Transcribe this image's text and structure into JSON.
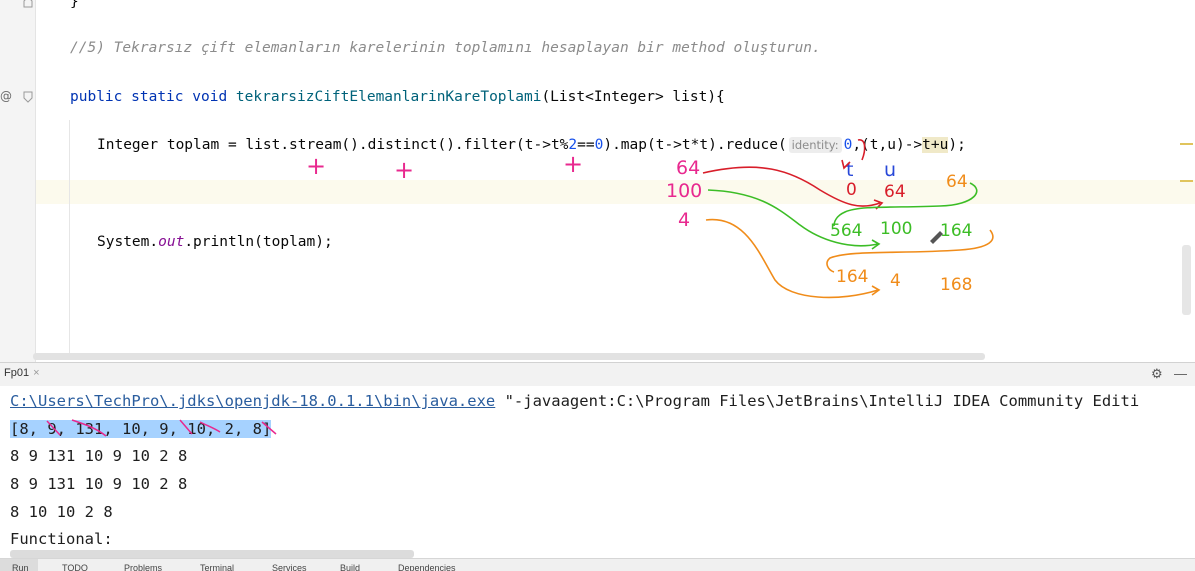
{
  "editor": {
    "closing_brace": "}",
    "comment": "//5) Tekrarsız çift elemanların karelerinin toplamını hesaplayan bir method oluşturun.",
    "method_sig": {
      "public": "public",
      "static": "static",
      "void": "void",
      "name": "tekrarsizCiftElemanlarinKareToplami",
      "params": "(List<Integer> list){"
    },
    "stream_line": {
      "part1": "Integer toplam = list.stream().distinct().filter(t->t%",
      "num2": "2",
      "eq": "==",
      "num0": "0",
      "part2": ").map(t->t*t).reduce(",
      "hint": "identity:",
      "identity": "0",
      "part3": ",(t,u)->",
      "sum": "t+u",
      "end": ");"
    },
    "print_line": {
      "prefix": "System.",
      "out": "out",
      "suffix": ".println(toplam);"
    },
    "gutter_at": "@"
  },
  "annotations": {
    "plus": [
      "+",
      "+",
      "+"
    ],
    "inputs": [
      "64",
      "100",
      "4"
    ],
    "col_t": "t",
    "col_u": "u",
    "row1": [
      "0",
      "64",
      "64"
    ],
    "row2": [
      "564",
      "100",
      "164"
    ],
    "row3": [
      "164",
      "4",
      "168"
    ],
    "colors": {
      "pink": "#e8298f",
      "red": "#d81e2a",
      "green": "#3cbd26",
      "orange": "#f08c1a",
      "blue": "#2747d8"
    }
  },
  "run_panel": {
    "tab_label": "Fp01",
    "tab_close": "×",
    "gear": "⚙",
    "minimize": "—"
  },
  "console": {
    "java_path": "C:\\Users\\TechPro\\.jdks\\openjdk-18.0.1.1\\bin\\java.exe",
    "java_args": " \"-javaagent:C:\\Program Files\\JetBrains\\IntelliJ IDEA Community Editi",
    "list_output": "[8, 9, 131, 10, 9, 10, 2, 8]",
    "line1": "8 9 131 10 9 10 2 8",
    "line2": "8 9 131 10 9 10 2 8",
    "line3": "8 10 10 2 8",
    "line4": "Functional:"
  },
  "status_bar": {
    "run": "Run",
    "todo": "TODO",
    "problems": "Problems",
    "terminal": "Terminal",
    "services": "Services",
    "build": "Build",
    "dependencies": "Dependencies"
  }
}
